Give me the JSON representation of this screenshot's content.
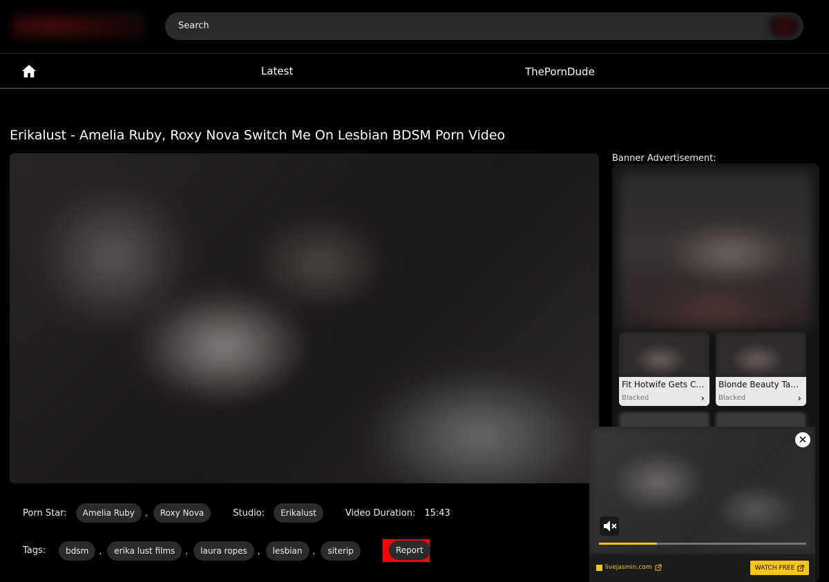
{
  "header": {
    "search_placeholder": "Search"
  },
  "nav": {
    "items": [
      {
        "label": "Latest"
      },
      {
        "label": "ThePornDude"
      }
    ]
  },
  "video": {
    "title": "Erikalust - Amelia Ruby, Roxy Nova Switch Me On Lesbian BDSM Porn Video"
  },
  "info": {
    "pornstar_label": "Porn Star:",
    "pornstars": [
      "Amelia Ruby",
      "Roxy Nova"
    ],
    "studio_label": "Studio:",
    "studio": "Erikalust",
    "duration_label": "Video Duration:",
    "duration": "15:43",
    "tags_label": "Tags:",
    "tags": [
      "bdsm",
      "erika lust films",
      "laura ropes",
      "lesbian",
      "siterip"
    ],
    "separator": ",",
    "report_label": "Report"
  },
  "sidebar": {
    "ad_label": "Banner Advertisement:",
    "thumbs": [
      {
        "title": "Fit Hotwife Gets Cr...",
        "studio": "Blacked"
      },
      {
        "title": "Blonde Beauty Tak...",
        "studio": "Blacked"
      }
    ]
  },
  "popup": {
    "site": "livejasmin.com",
    "cta": "WATCH FREE",
    "progress": 0.28,
    "accent": "#f5c518"
  },
  "colors": {
    "background": "#000000",
    "pill": "#2b2b2b",
    "report_highlight": "#ff0000"
  }
}
